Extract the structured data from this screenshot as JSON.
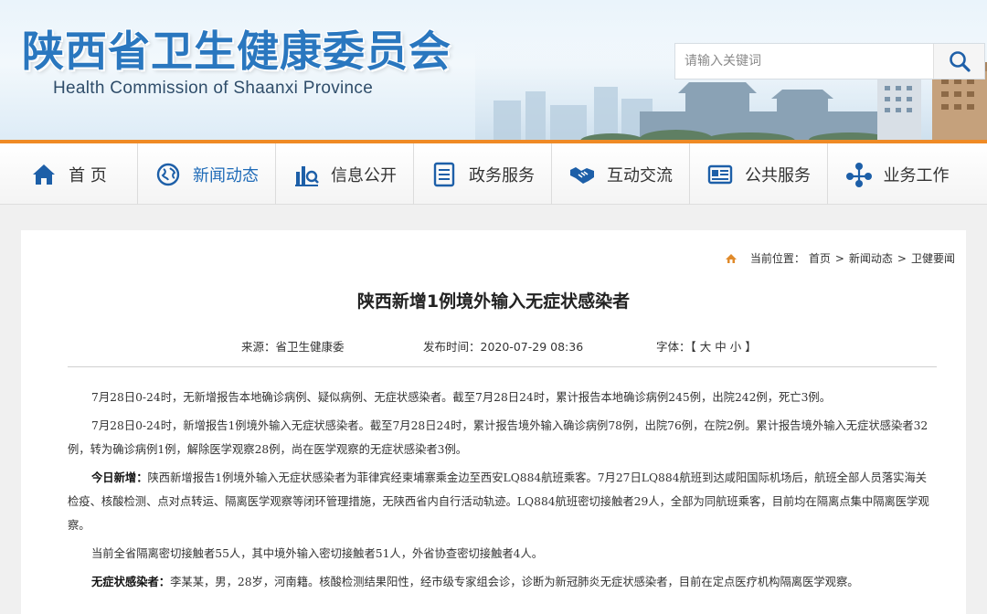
{
  "header": {
    "title": "陕西省卫生健康委员会",
    "subtitle": "Health Commission of Shaanxi Province",
    "search": {
      "placeholder": "请输入关键词",
      "button_icon": "search-icon"
    }
  },
  "nav": {
    "items": [
      {
        "label": "首 页",
        "icon": "home-icon"
      },
      {
        "label": "新闻动态",
        "icon": "globe-icon"
      },
      {
        "label": "信息公开",
        "icon": "bar-chart-icon"
      },
      {
        "label": "政务服务",
        "icon": "document-icon"
      },
      {
        "label": "互动交流",
        "icon": "handshake-icon"
      },
      {
        "label": "公共服务",
        "icon": "id-card-icon"
      },
      {
        "label": "业务工作",
        "icon": "network-icon"
      }
    ],
    "active_index": 1
  },
  "breadcrumb": {
    "prefix": "当前位置：",
    "items": [
      "首页",
      "新闻动态",
      "卫健要闻"
    ],
    "separator": ">"
  },
  "article": {
    "title": "陕西新增1例境外输入无症状感染者",
    "source": "来源：省卫生健康委",
    "published": "发布时间：2020-07-29 08:36",
    "font_label": "字体：",
    "font_sizes": [
      "大",
      "中",
      "小"
    ],
    "paragraphs": [
      {
        "lead": "",
        "text": "7月28日0-24时，无新增报告本地确诊病例、疑似病例、无症状感染者。截至7月28日24时，累计报告本地确诊病例245例，出院242例，死亡3例。"
      },
      {
        "lead": "",
        "text": "7月28日0-24时，新增报告1例境外输入无症状感染者。截至7月28日24时，累计报告境外输入确诊病例78例，出院76例，在院2例。累计报告境外输入无症状感染者32例，转为确诊病例1例，解除医学观察28例，尚在医学观察的无症状感染者3例。"
      },
      {
        "lead": "今日新增：",
        "text": "陕西新增报告1例境外输入无症状感染者为菲律宾经柬埔寨乘金边至西安LQ884航班乘客。7月27日LQ884航班到达咸阳国际机场后，航班全部人员落实海关检疫、核酸检测、点对点转运、隔离医学观察等闭环管理措施，无陕西省内自行活动轨迹。LQ884航班密切接触者29人，全部为同航班乘客，目前均在隔离点集中隔离医学观察。"
      },
      {
        "lead": "",
        "text": "当前全省隔离密切接触者55人，其中境外输入密切接触者51人，外省协查密切接触者4人。"
      },
      {
        "lead": "无症状感染者：",
        "text": "李某某，男，28岁，河南籍。核酸检测结果阳性，经市级专家组会诊，诊断为新冠肺炎无症状感染者，目前在定点医疗机构隔离医学观察。"
      }
    ]
  },
  "colors": {
    "brand_blue": "#2a77bf",
    "accent_orange": "#ef8a25",
    "active_nav": "#1f6bb8",
    "icon_blue": "#1d5fa8"
  }
}
